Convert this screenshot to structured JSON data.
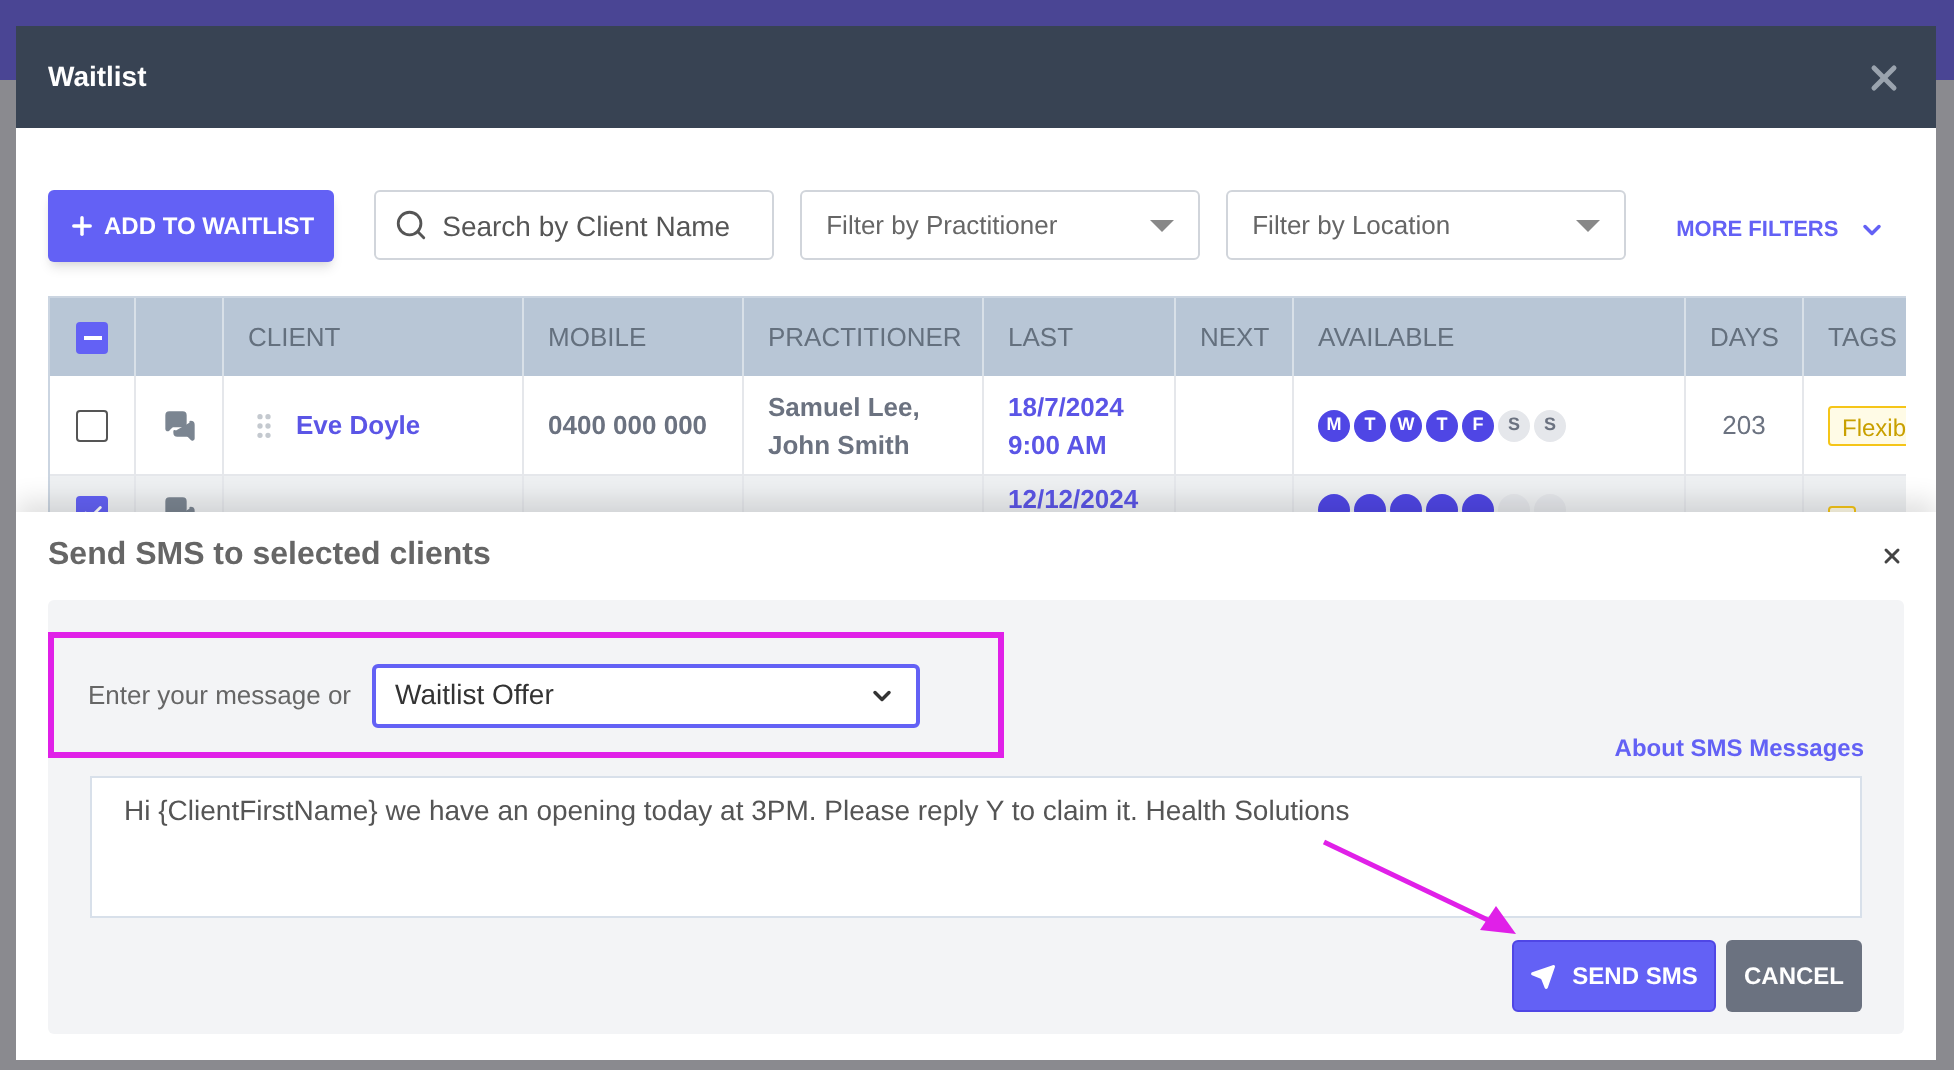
{
  "window": {
    "title": "Waitlist"
  },
  "toolbar": {
    "add_button": "ADD TO WAITLIST",
    "search": {
      "placeholder": "Search by Client Name"
    },
    "practitioner_filter": {
      "placeholder": "Filter by Practitioner"
    },
    "location_filter": {
      "placeholder": "Filter by Location"
    },
    "more_filters": "MORE FILTERS"
  },
  "table": {
    "select_all_indeterminate": true,
    "columns": [
      "CLIENT",
      "MOBILE",
      "PRACTITIONER",
      "LAST",
      "NEXT",
      "AVAILABLE",
      "DAYS",
      "TAGS"
    ],
    "rows": [
      {
        "checked": false,
        "client": "Eve Doyle",
        "mobile": "0400 000 000",
        "practitioner": [
          "Samuel Lee,",
          "John Smith"
        ],
        "last": [
          "18/7/2024",
          "9:00 AM"
        ],
        "days": "203",
        "tag": "Flexib",
        "available": [
          {
            "label": "M",
            "on": true
          },
          {
            "label": "T",
            "on": true
          },
          {
            "label": "W",
            "on": true
          },
          {
            "label": "T",
            "on": true
          },
          {
            "label": "F",
            "on": true
          },
          {
            "label": "S",
            "on": false
          },
          {
            "label": "S",
            "on": false
          }
        ]
      },
      {
        "checked": true,
        "last": [
          "12/12/2024"
        ],
        "available": [
          {
            "on": true
          },
          {
            "on": true
          },
          {
            "on": true
          },
          {
            "on": true
          },
          {
            "on": true
          },
          {
            "on": false
          },
          {
            "on": false
          }
        ]
      }
    ]
  },
  "sms_dialog": {
    "title": "Send SMS to selected clients",
    "label": "Enter your message or",
    "template": "Waitlist Offer",
    "about_link": "About SMS Messages",
    "message": "Hi {ClientFirstName} we have an opening today at 3PM. Please reply Y to claim it. Health Solutions",
    "send_button": "SEND SMS",
    "cancel_button": "CANCEL"
  }
}
